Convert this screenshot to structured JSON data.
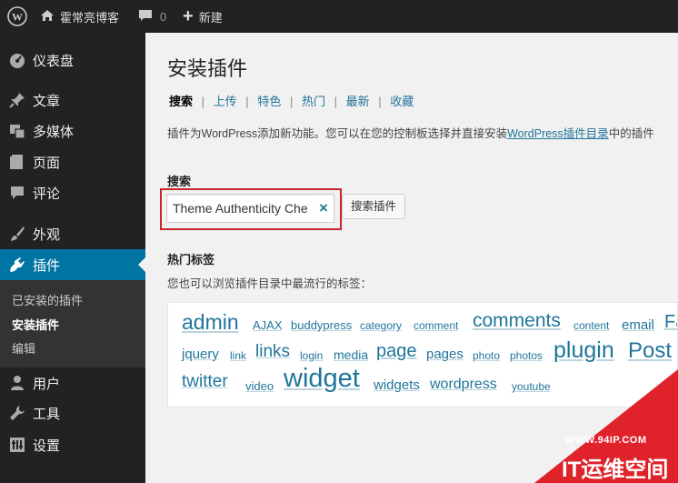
{
  "adminbar": {
    "site_name": "霍常亮博客",
    "comments_count": "0",
    "new_label": "新建"
  },
  "sidebar": {
    "items": [
      {
        "label": "仪表盘"
      },
      {
        "label": "文章"
      },
      {
        "label": "多媒体"
      },
      {
        "label": "页面"
      },
      {
        "label": "评论"
      },
      {
        "label": "外观"
      },
      {
        "label": "插件"
      },
      {
        "label": "用户"
      },
      {
        "label": "工具"
      },
      {
        "label": "设置"
      }
    ],
    "submenu": [
      {
        "label": "已安装的插件"
      },
      {
        "label": "安装插件"
      },
      {
        "label": "编辑"
      }
    ]
  },
  "page": {
    "title": "安装插件",
    "tabs": [
      {
        "label": "搜索"
      },
      {
        "label": "上传"
      },
      {
        "label": "特色"
      },
      {
        "label": "热门"
      },
      {
        "label": "最新"
      },
      {
        "label": "收藏"
      }
    ],
    "desc_prefix": "插件为WordPress添加新功能。您可以在您的控制板选择并直接安装",
    "desc_link": "WordPress插件目录",
    "desc_suffix": "中的插件",
    "search_heading": "搜索",
    "search_value": "Theme Authenticity Che",
    "search_button": "搜索插件",
    "popular_heading": "热门标签",
    "popular_desc": "您也可以浏览插件目录中最流行的标签：",
    "tags": [
      "admin",
      "AJAX",
      "buddypress",
      "category",
      "comment",
      "comments",
      "content",
      "email",
      "Fa",
      "jquery",
      "link",
      "links",
      "login",
      "media",
      "page",
      "pages",
      "photo",
      "photos",
      "plugin",
      "Post",
      "twitter",
      "video",
      "widget",
      "widgets",
      "wordpress",
      "youtube"
    ]
  },
  "watermark": {
    "url": "WWW.94IP.COM",
    "brand": "IT运维空间"
  },
  "colors": {
    "accent": "#0074a2",
    "link": "#21759b",
    "highlight_box": "#c8262b",
    "watermark_red": "#e0222a"
  }
}
